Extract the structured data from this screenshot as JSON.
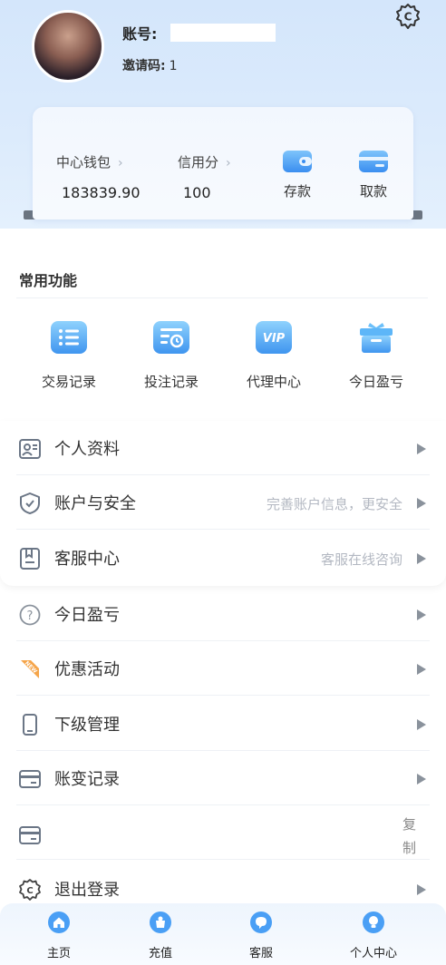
{
  "profile": {
    "account_label": "账号:",
    "invite_label": "邀请码:",
    "invite_code": "1"
  },
  "wallet": {
    "center_wallet_label": "中心钱包",
    "center_wallet_value": "183839.90",
    "credit_label": "信用分",
    "credit_value": "100",
    "deposit_label": "存款",
    "withdraw_label": "取款",
    "chevron": "›"
  },
  "quick": {
    "title": "常用功能",
    "items": [
      {
        "label": "交易记录",
        "icon": "list-icon"
      },
      {
        "label": "投注记录",
        "icon": "bet-record-icon"
      },
      {
        "label": "代理中心",
        "icon": "vip-icon"
      },
      {
        "label": "今日盈亏",
        "icon": "gift-box-icon"
      }
    ]
  },
  "menu": {
    "profile": "个人资料",
    "security": "账户与安全",
    "security_hint": "完善账户信息，更安全",
    "service": "客服中心",
    "service_hint": "客服在线咨询",
    "today_pl": "今日盈亏",
    "promotions": "优惠活动",
    "subordinates": "下级管理",
    "balance_log": "账变记录",
    "copy": "复制",
    "logout": "退出登录"
  },
  "nav": {
    "items": [
      {
        "label": "主页"
      },
      {
        "label": "充值"
      },
      {
        "label": "客服"
      },
      {
        "label": "个人中心"
      }
    ]
  },
  "colors": {
    "accent": "#4a9ff5",
    "header_bg": "#d4e6fb",
    "icon_gray": "#6b7686",
    "promo_orange": "#f5a54a"
  }
}
